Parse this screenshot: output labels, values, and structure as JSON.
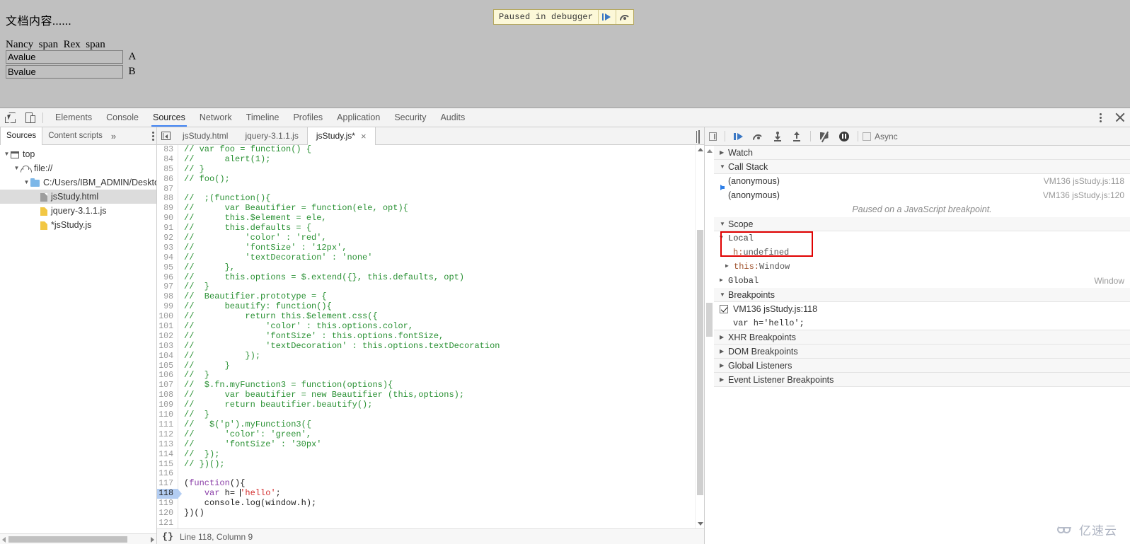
{
  "page": {
    "doc_text": "文档内容......",
    "span_line": "Nancy  span  Rex  span",
    "input_a_value": "Avalue",
    "input_a_label": "A",
    "input_b_value": "Bvalue",
    "input_b_label": "B"
  },
  "paused_banner": {
    "text": "Paused in debugger",
    "resume_icon": "resume-icon",
    "step_over_icon": "step-over-icon"
  },
  "devtools": {
    "inspect_icon": "inspect-element-icon",
    "device_icon": "device-toolbar-icon",
    "tabs": [
      {
        "label": "Elements",
        "active": false
      },
      {
        "label": "Console",
        "active": false
      },
      {
        "label": "Sources",
        "active": true
      },
      {
        "label": "Network",
        "active": false
      },
      {
        "label": "Timeline",
        "active": false
      },
      {
        "label": "Profiles",
        "active": false
      },
      {
        "label": "Application",
        "active": false
      },
      {
        "label": "Security",
        "active": false
      },
      {
        "label": "Audits",
        "active": false
      }
    ],
    "more_icon": "kebab-menu-icon",
    "close_icon": "close-icon"
  },
  "navigator": {
    "tabs": [
      {
        "label": "Sources",
        "active": true
      },
      {
        "label": "Content scripts",
        "active": false
      }
    ],
    "more_label": "»",
    "tree": [
      {
        "label": "top",
        "icon": "frame-icon",
        "indent": 0,
        "twisty": "▼",
        "selected": false
      },
      {
        "label": "file://",
        "icon": "cloud-icon",
        "indent": 1,
        "twisty": "▼",
        "selected": false
      },
      {
        "label": "C:/Users/IBM_ADMIN/Desktop/",
        "icon": "folder-icon",
        "indent": 2,
        "twisty": "▼",
        "selected": false
      },
      {
        "label": "jsStudy.html",
        "icon": "html-file-icon",
        "indent": 3,
        "twisty": "",
        "selected": true
      },
      {
        "label": "jquery-3.1.1.js",
        "icon": "js-file-icon",
        "indent": 3,
        "twisty": "",
        "selected": false
      },
      {
        "label": "*jsStudy.js",
        "icon": "js-file-icon",
        "indent": 3,
        "twisty": "",
        "selected": false
      }
    ]
  },
  "editor": {
    "sidebar_toggle_icon": "navigator-toggle-icon",
    "split_icon": "split-editor-icon",
    "tabs": [
      {
        "label": "jsStudy.html",
        "active": false,
        "closable": false
      },
      {
        "label": "jquery-3.1.1.js",
        "active": false,
        "closable": false
      },
      {
        "label": "jsStudy.js*",
        "active": true,
        "closable": true
      }
    ],
    "close_tab_label": "×",
    "pretty_print_label": "{}",
    "status_text": "Line 118, Column 9",
    "execution_line": 118,
    "lines": [
      {
        "n": 83,
        "parts": [
          {
            "t": "// var foo = function() {",
            "c": "cmt"
          }
        ]
      },
      {
        "n": 84,
        "parts": [
          {
            "t": "//      alert(1);",
            "c": "cmt"
          }
        ]
      },
      {
        "n": 85,
        "parts": [
          {
            "t": "// }",
            "c": "cmt"
          }
        ]
      },
      {
        "n": 86,
        "parts": [
          {
            "t": "// foo();",
            "c": "cmt"
          }
        ]
      },
      {
        "n": 87,
        "parts": [
          {
            "t": "",
            "c": "cmt"
          }
        ]
      },
      {
        "n": 88,
        "parts": [
          {
            "t": "//  ;(function(){",
            "c": "cmt"
          }
        ]
      },
      {
        "n": 89,
        "parts": [
          {
            "t": "//      var Beautifier = function(ele, opt){",
            "c": "cmt"
          }
        ]
      },
      {
        "n": 90,
        "parts": [
          {
            "t": "//      this.$element = ele,",
            "c": "cmt"
          }
        ]
      },
      {
        "n": 91,
        "parts": [
          {
            "t": "//      this.defaults = {",
            "c": "cmt"
          }
        ]
      },
      {
        "n": 92,
        "parts": [
          {
            "t": "//          'color' : 'red',",
            "c": "cmt"
          }
        ]
      },
      {
        "n": 93,
        "parts": [
          {
            "t": "//          'fontSize' : '12px',",
            "c": "cmt"
          }
        ]
      },
      {
        "n": 94,
        "parts": [
          {
            "t": "//          'textDecoration' : 'none'",
            "c": "cmt"
          }
        ]
      },
      {
        "n": 95,
        "parts": [
          {
            "t": "//      },",
            "c": "cmt"
          }
        ]
      },
      {
        "n": 96,
        "parts": [
          {
            "t": "//      this.options = $.extend({}, this.defaults, opt)",
            "c": "cmt"
          }
        ]
      },
      {
        "n": 97,
        "parts": [
          {
            "t": "//  }",
            "c": "cmt"
          }
        ]
      },
      {
        "n": 98,
        "parts": [
          {
            "t": "//  Beautifier.prototype = {",
            "c": "cmt"
          }
        ]
      },
      {
        "n": 99,
        "parts": [
          {
            "t": "//      beautify: function(){",
            "c": "cmt"
          }
        ]
      },
      {
        "n": 100,
        "parts": [
          {
            "t": "//          return this.$element.css({",
            "c": "cmt"
          }
        ]
      },
      {
        "n": 101,
        "parts": [
          {
            "t": "//              'color' : this.options.color,",
            "c": "cmt"
          }
        ]
      },
      {
        "n": 102,
        "parts": [
          {
            "t": "//              'fontSize' : this.options.fontSize,",
            "c": "cmt"
          }
        ]
      },
      {
        "n": 103,
        "parts": [
          {
            "t": "//              'textDecoration' : this.options.textDecoration",
            "c": "cmt"
          }
        ]
      },
      {
        "n": 104,
        "parts": [
          {
            "t": "//          });",
            "c": "cmt"
          }
        ]
      },
      {
        "n": 105,
        "parts": [
          {
            "t": "//      }",
            "c": "cmt"
          }
        ]
      },
      {
        "n": 106,
        "parts": [
          {
            "t": "//  }",
            "c": "cmt"
          }
        ]
      },
      {
        "n": 107,
        "parts": [
          {
            "t": "//  $.fn.myFunction3 = function(options){",
            "c": "cmt"
          }
        ]
      },
      {
        "n": 108,
        "parts": [
          {
            "t": "//      var beautifier = new Beautifier (this,options);",
            "c": "cmt"
          }
        ]
      },
      {
        "n": 109,
        "parts": [
          {
            "t": "//      return beautifier.beautify();",
            "c": "cmt"
          }
        ]
      },
      {
        "n": 110,
        "parts": [
          {
            "t": "//  }",
            "c": "cmt"
          }
        ]
      },
      {
        "n": 111,
        "parts": [
          {
            "t": "//   $('p').myFunction3({",
            "c": "cmt"
          }
        ]
      },
      {
        "n": 112,
        "parts": [
          {
            "t": "//      'color': 'green',",
            "c": "cmt"
          }
        ]
      },
      {
        "n": 113,
        "parts": [
          {
            "t": "//      'fontSize' : '30px'",
            "c": "cmt"
          }
        ]
      },
      {
        "n": 114,
        "parts": [
          {
            "t": "//  });",
            "c": "cmt"
          }
        ]
      },
      {
        "n": 115,
        "parts": [
          {
            "t": "// })();",
            "c": "cmt"
          }
        ]
      },
      {
        "n": 116,
        "parts": [
          {
            "t": "",
            "c": ""
          }
        ]
      },
      {
        "n": 117,
        "parts": [
          {
            "t": "(",
            "c": ""
          },
          {
            "t": "function",
            "c": "kw"
          },
          {
            "t": "(){",
            "c": ""
          }
        ]
      },
      {
        "n": 118,
        "parts": [
          {
            "t": "    ",
            "c": ""
          },
          {
            "t": "var",
            "c": "kw"
          },
          {
            "t": " h= ",
            "c": ""
          },
          {
            "t": "CARET",
            "c": "caret"
          },
          {
            "t": "'hello'",
            "c": "str"
          },
          {
            "t": ";",
            "c": ""
          }
        ]
      },
      {
        "n": 119,
        "parts": [
          {
            "t": "    console.log(window.h);",
            "c": ""
          }
        ]
      },
      {
        "n": 120,
        "parts": [
          {
            "t": "})()",
            "c": ""
          }
        ]
      },
      {
        "n": 121,
        "parts": [
          {
            "t": "",
            "c": ""
          }
        ]
      }
    ]
  },
  "debugger": {
    "toolbar": {
      "panel_toggle_icon": "debug-sidebar-toggle-icon",
      "resume_icon": "resume-script-icon",
      "step_over_icon": "step-over-next-call-icon",
      "step_into_icon": "step-into-next-call-icon",
      "step_out_icon": "step-out-of-function-icon",
      "deactivate_breakpoints_icon": "deactivate-breakpoints-icon",
      "pause_on_exceptions_icon": "pause-on-exceptions-icon",
      "async_label": "Async",
      "async_checked": false
    },
    "watch": {
      "title": "Watch",
      "expanded": false
    },
    "call_stack": {
      "title": "Call Stack",
      "expanded": true,
      "frames": [
        {
          "name": "(anonymous)",
          "location": "VM136 jsStudy.js:118",
          "current": true
        },
        {
          "name": "(anonymous)",
          "location": "VM136 jsStudy.js:120",
          "current": false
        }
      ],
      "note": "Paused on a JavaScript breakpoint."
    },
    "scope": {
      "title": "Scope",
      "expanded": true,
      "local": {
        "label": "Local",
        "twisty": "▼",
        "vars": [
          {
            "key": "h:",
            "value": " undefined",
            "twisty": ""
          }
        ],
        "this_key": "this:",
        "this_value": " Window",
        "this_twisty": "▶"
      },
      "global": {
        "label": "Global",
        "twisty": "▶",
        "value": "Window"
      },
      "highlight_color": "#e00000"
    },
    "breakpoints": {
      "title": "Breakpoints",
      "expanded": true,
      "items": [
        {
          "location": "VM136 jsStudy.js:118",
          "code": "var h='hello';",
          "checked": true
        }
      ]
    },
    "other_sections": [
      {
        "title": "XHR Breakpoints",
        "twisty": "▶"
      },
      {
        "title": "DOM Breakpoints",
        "twisty": "▶"
      },
      {
        "title": "Global Listeners",
        "twisty": "▶"
      },
      {
        "title": "Event Listener Breakpoints",
        "twisty": "▶"
      }
    ]
  },
  "watermark": {
    "text": "亿速云"
  }
}
